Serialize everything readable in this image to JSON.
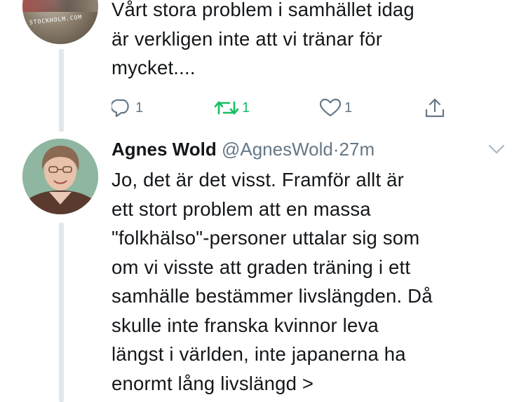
{
  "tweet1": {
    "text_lines": [
      "Vårt stora problem i samhället idag",
      "är verkligen inte att vi tränar för",
      "mycket...."
    ],
    "avatar_stamp": "STOCKHOLM.COM",
    "actions": {
      "reply_count": "1",
      "retweet_count": "1",
      "like_count": "1"
    },
    "colors": {
      "retweet_active": "#17bf63",
      "icon_gray": "#657786"
    }
  },
  "tweet2": {
    "author_name": "Agnes Wold",
    "author_handle": "@AgnesWold",
    "separator": "·",
    "time": "27m",
    "text_lines": [
      "Jo, det är det visst. Framför allt är",
      "ett stort problem att en massa",
      "\"folkhälso\"-personer uttalar sig som",
      "om vi visste att graden träning i ett",
      "samhälle bestämmer livslängden. Då",
      "skulle inte franska kvinnor leva",
      "längst i världen, inte japanerna ha",
      "enormt lång livslängd >"
    ]
  },
  "icons": {
    "reply": "reply-icon",
    "retweet": "retweet-icon",
    "like": "heart-icon",
    "share": "share-icon",
    "more": "chevron-down-icon"
  }
}
